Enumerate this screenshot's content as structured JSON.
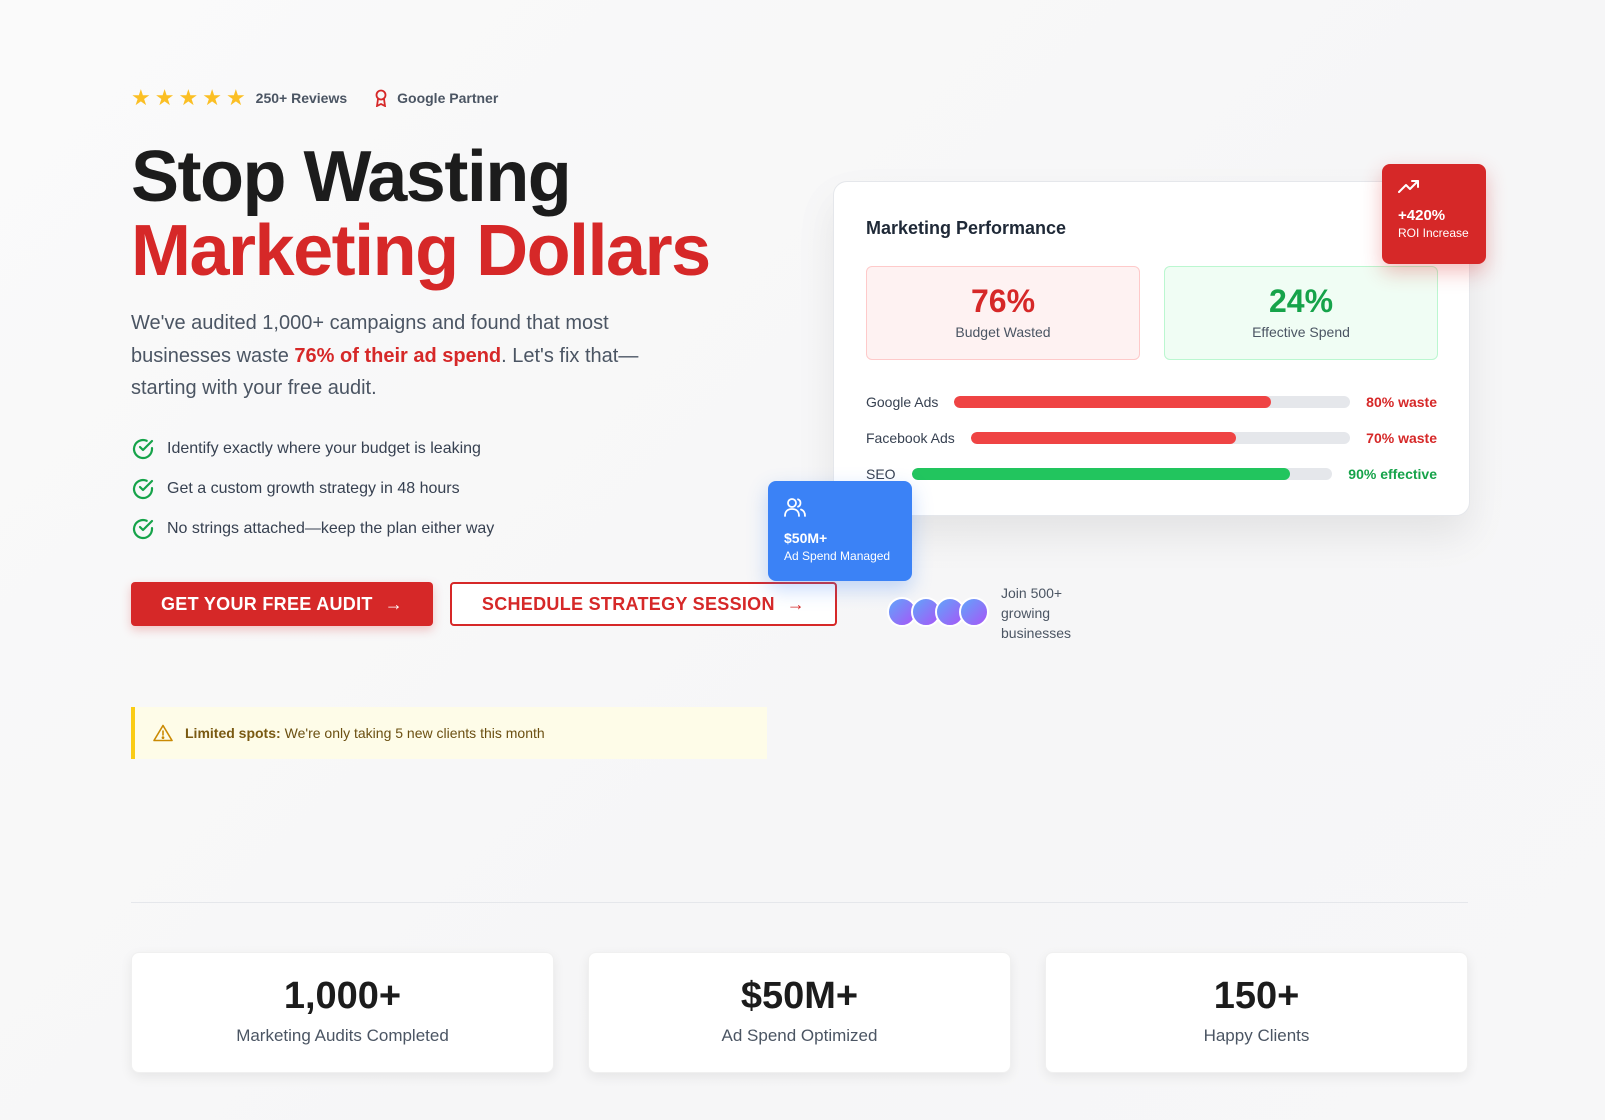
{
  "trust": {
    "stars": [
      "★",
      "★",
      "★",
      "★",
      "★"
    ],
    "reviews": "250+ Reviews",
    "partner": "Google Partner"
  },
  "hero": {
    "title_line1": "Stop Wasting",
    "title_line2": "Marketing Dollars",
    "subtext_pre": "We've audited 1,000+ campaigns and found that most businesses waste ",
    "subtext_highlight": "76% of their ad spend",
    "subtext_post": ". Let's fix that—starting with your free audit.",
    "checklist": [
      "Identify exactly where your budget is leaking",
      "Get a custom growth strategy in 48 hours",
      "No strings attached—keep the plan either way"
    ],
    "cta_primary": "GET YOUR FREE AUDIT",
    "cta_secondary": "SCHEDULE STRATEGY SESSION",
    "notice_bold": "Limited spots:",
    "notice_text": "We're only taking 5 new clients this month"
  },
  "performance": {
    "title": "Marketing Performance",
    "wasted_value": "76%",
    "wasted_label": "Budget Wasted",
    "effective_value": "24%",
    "effective_label": "Effective Spend",
    "channels": [
      {
        "name": "Google Ads",
        "fill": 0.8,
        "status": "80% waste",
        "kind": "waste"
      },
      {
        "name": "Facebook Ads",
        "fill": 0.7,
        "status": "70% waste",
        "kind": "waste"
      },
      {
        "name": "SEO",
        "fill": 0.9,
        "status": "90% effective",
        "kind": "effective"
      }
    ]
  },
  "roi_badge": {
    "value": "+420%",
    "label": "ROI Increase",
    "icon": "trending-up-icon"
  },
  "spend_badge": {
    "value": "$50M+",
    "label": "Ad Spend Managed",
    "icon": "users-icon"
  },
  "social_proof": {
    "text": "Join 500+ growing businesses",
    "avatar_count": 4
  },
  "stats": [
    {
      "value": "1,000+",
      "label": "Marketing Audits Completed"
    },
    {
      "value": "$50M+",
      "label": "Ad Spend Optimized"
    },
    {
      "value": "150+",
      "label": "Happy Clients"
    }
  ],
  "colors": {
    "brand_red": "#d62828",
    "success_green": "#16a34a",
    "accent_blue": "#3b82f6",
    "warning_yellow": "#facc15",
    "star_gold": "#fbbf24"
  }
}
